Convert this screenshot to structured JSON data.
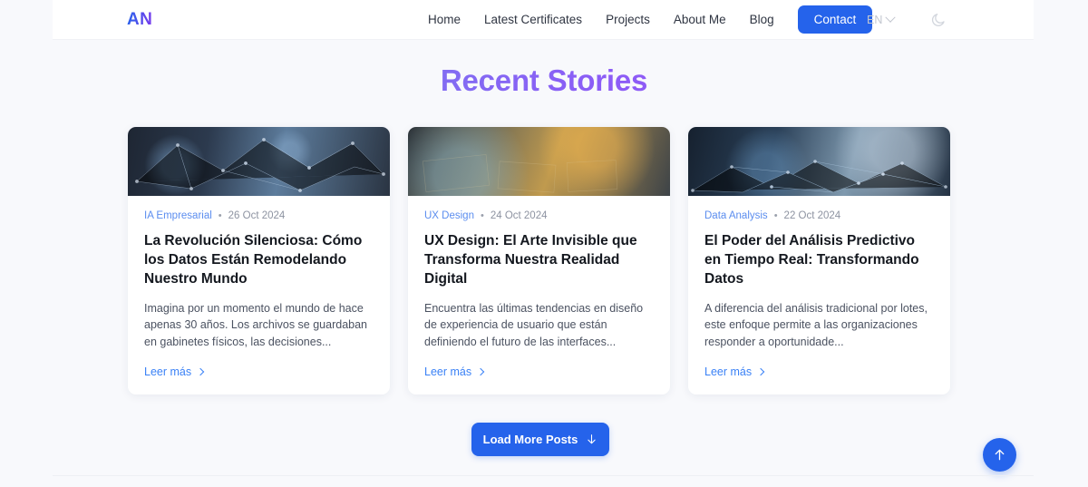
{
  "header": {
    "logo": "AN",
    "nav": [
      {
        "label": "Home"
      },
      {
        "label": "Latest Certificates"
      },
      {
        "label": "Projects"
      },
      {
        "label": "About Me"
      },
      {
        "label": "Blog"
      }
    ],
    "contact_label": "Contact",
    "language": "EN",
    "language_icon": "chevron-down-icon",
    "theme_icon": "moon-icon"
  },
  "main": {
    "title": "Recent Stories",
    "posts": [
      {
        "category": "IA Empresarial",
        "separator": "•",
        "date": "26 Oct 2024",
        "title": "La Revolución Silenciosa: Cómo los Datos Están Remodelando Nuestro Mundo",
        "excerpt": "Imagina por un momento el mundo de hace apenas 30 años. Los archivos se guardaban en gabinetes físicos, las decisiones...",
        "read_more": "Leer más",
        "image_alt": "people-network-image"
      },
      {
        "category": "UX Design",
        "separator": "•",
        "date": "24 Oct 2024",
        "title": "UX Design: El Arte Invisible que Transforma Nuestra Realidad Digital",
        "excerpt": "Encuentra las últimas tendencias en diseño de experiencia de usuario que están definiendo el futuro de las interfaces...",
        "read_more": "Leer más",
        "image_alt": "design-desk-image"
      },
      {
        "category": "Data Analysis",
        "separator": "•",
        "date": "22 Oct 2024",
        "title": "El Poder del Análisis Predictivo en Tiempo Real: Transformando Datos",
        "excerpt": "A diferencia del análisis tradicional por lotes, este enfoque permite a las organizaciones responder a oportunidade...",
        "read_more": "Leer más",
        "image_alt": "laptop-hands-network-image"
      }
    ],
    "load_more_label": "Load More Posts",
    "load_more_icon": "arrow-down-icon"
  },
  "floating": {
    "scroll_top_icon": "arrow-up-icon"
  },
  "colors": {
    "accent_blue": "#2563eb",
    "link_blue": "#3b82f6",
    "gradient_purple": "#8b5cf6",
    "page_bg": "#f8f9fc"
  }
}
